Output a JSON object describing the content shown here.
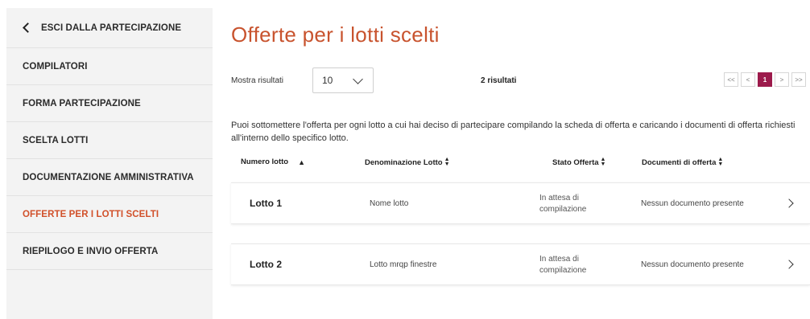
{
  "sidebar": {
    "back_label": "ESCI DALLA PARTECIPAZIONE",
    "items": [
      {
        "label": "COMPILATORI"
      },
      {
        "label": "FORMA PARTECIPAZIONE"
      },
      {
        "label": "SCELTA LOTTI"
      },
      {
        "label": "DOCUMENTAZIONE AMMINISTRATIVA"
      },
      {
        "label": "OFFERTE PER I LOTTI SCELTI"
      },
      {
        "label": "RIEPILOGO E INVIO OFFERTA"
      }
    ],
    "active_item": "OFFERTE PER I LOTTI SCELTI"
  },
  "main": {
    "title": "Offerte per i lotti scelti",
    "show_results_label": "Mostra risultati",
    "page_size": "10",
    "results_count": "2 risultati",
    "pager": {
      "first": "<<",
      "prev": "<",
      "current": "1",
      "next": ">",
      "last": ">>"
    },
    "intro": "Puoi sottomettere l'offerta per ogni lotto a cui hai deciso di partecipare compilando la scheda di offerta e caricando i documenti di offerta richiesti all'interno dello specifico lotto.",
    "columns": {
      "lot_number": "Numero lotto",
      "lot_name": "Denominazione Lotto",
      "status": "Stato Offerta",
      "documents": "Documenti di offerta"
    },
    "rows": [
      {
        "lot": "Lotto 1",
        "name": "Nome lotto",
        "status": "In attesa di compilazione",
        "docs": "Nessun documento presente"
      },
      {
        "lot": "Lotto 2",
        "name": "Lotto mrqp finestre",
        "status": "In attesa di compilazione",
        "docs": "Nessun documento presente"
      }
    ]
  },
  "colors": {
    "accent": "#c8532e",
    "pager_current": "#9c1a4b",
    "sidebar_bg": "#f3f3f3"
  }
}
